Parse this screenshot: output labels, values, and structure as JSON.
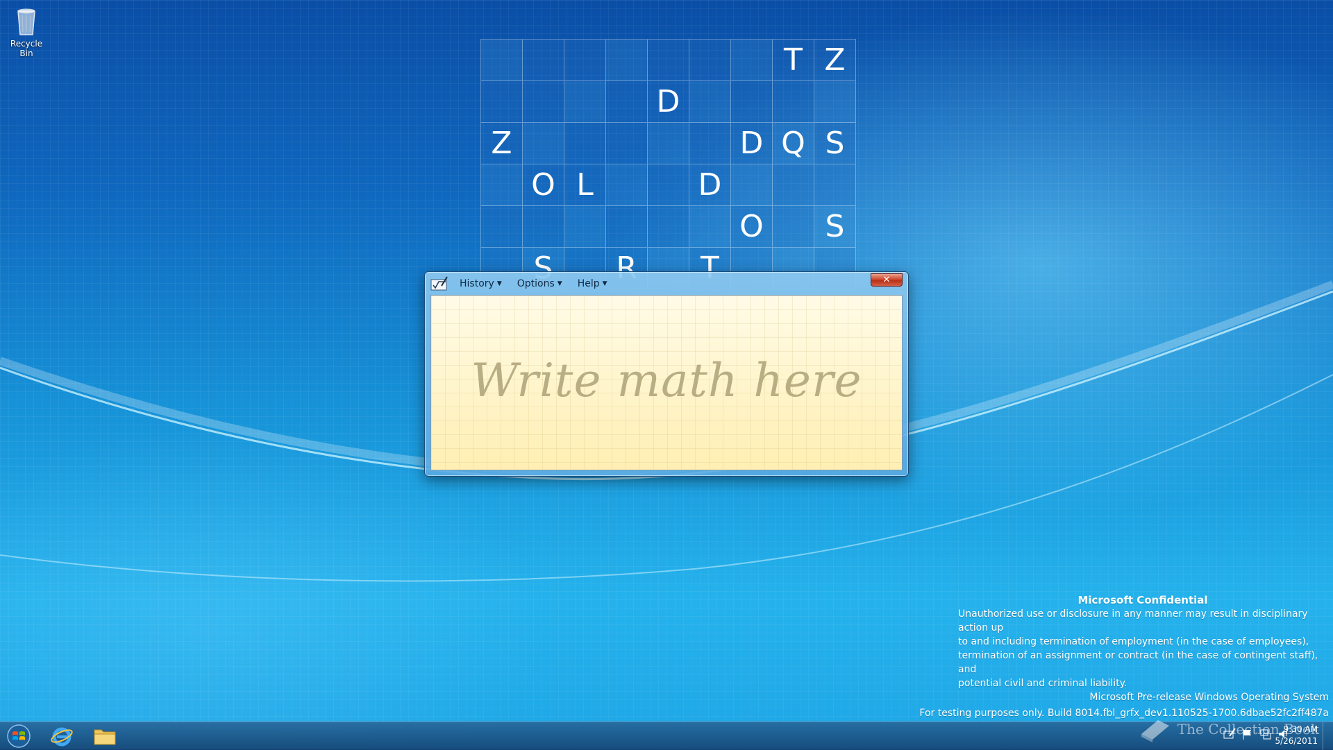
{
  "desktop": {
    "recycle_bin_label": "Recycle Bin"
  },
  "letter_grid": {
    "rows": [
      [
        "",
        "",
        "",
        "",
        "",
        "",
        "",
        "T",
        "Z"
      ],
      [
        "",
        "",
        "",
        "",
        "D",
        "",
        "",
        "",
        ""
      ],
      [
        "Z",
        "",
        "",
        "",
        "",
        "",
        "D",
        "Q",
        "S"
      ],
      [
        "",
        "O",
        "L",
        "",
        "",
        "D",
        "",
        "",
        ""
      ],
      [
        "",
        "",
        "",
        "",
        "",
        "",
        "O",
        "",
        "S"
      ],
      [
        "",
        "S",
        "",
        "R",
        "",
        "T",
        "",
        "",
        ""
      ]
    ]
  },
  "math_input_window": {
    "menus": [
      "History",
      "Options",
      "Help"
    ],
    "close_label": "✕",
    "placeholder": "Write math here"
  },
  "confidential_notice": {
    "title": "Microsoft Confidential",
    "body_lines": [
      "Unauthorized use or disclosure in any manner may result in disciplinary action up",
      "to and including termination of employment (in the case of employees),",
      "termination of an assignment or contract (in the case of contingent staff), and",
      "potential civil and criminal liability."
    ],
    "os_line": "Microsoft Pre-release Windows Operating System",
    "build_line": "For testing purposes only. Build 8014.fbl_grfx_dev1.110525-1700.6dbae52fc2ff487a"
  },
  "watermark": {
    "text": "The Collection Book"
  },
  "taskbar": {
    "clock_time": "9:30 AM",
    "clock_date": "5/26/2011"
  },
  "colors": {
    "desktop_blue": "#1793d8",
    "note_yellow": "#fff4c6",
    "close_red": "#cf4a2e"
  }
}
